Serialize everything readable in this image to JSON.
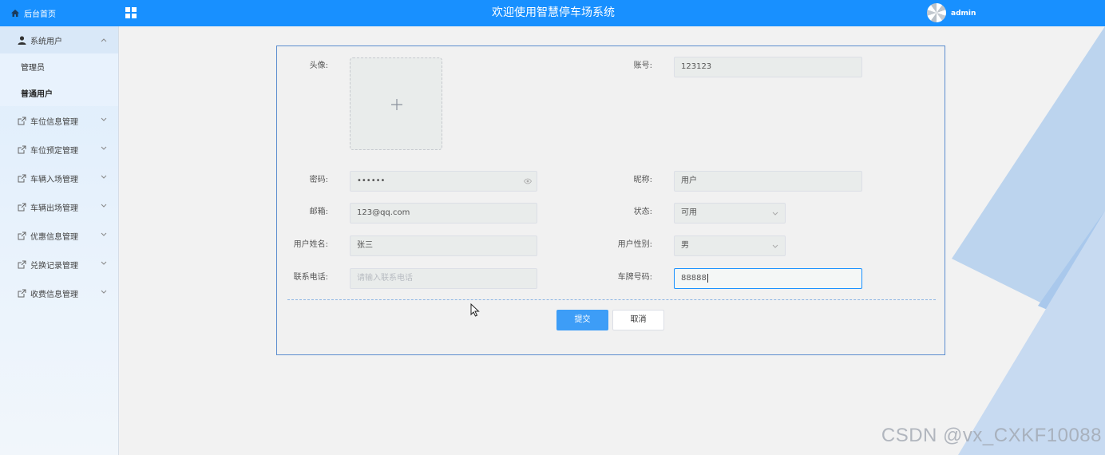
{
  "sidebar": {
    "home_label": "后台首页",
    "group_open": {
      "label": "系统用户"
    },
    "sub_items": [
      {
        "label": "管理员"
      },
      {
        "label": "普通用户"
      }
    ],
    "items": [
      {
        "label": "车位信息管理"
      },
      {
        "label": "车位预定管理"
      },
      {
        "label": "车辆入场管理"
      },
      {
        "label": "车辆出场管理"
      },
      {
        "label": "优惠信息管理"
      },
      {
        "label": "兑换记录管理"
      },
      {
        "label": "收费信息管理"
      }
    ]
  },
  "header": {
    "title": "欢迎使用智慧停车场系统",
    "username": "admin"
  },
  "form": {
    "avatar_label": "头像:",
    "account_label": "账号:",
    "account_value": "123123",
    "password_label": "密码:",
    "password_value": "••••••",
    "nickname_label": "昵称:",
    "nickname_value": "用户",
    "email_label": "邮箱:",
    "email_value": "123@qq.com",
    "status_label": "状态:",
    "status_value": "可用",
    "name_label": "用户姓名:",
    "name_value": "张三",
    "gender_label": "用户性别:",
    "gender_value": "男",
    "phone_label": "联系电话:",
    "phone_placeholder": "请输入联系电话",
    "plate_label": "车牌号码:",
    "plate_value": "88888",
    "submit_label": "提交",
    "cancel_label": "取消"
  },
  "watermark": "CSDN @vx_CXKF10088",
  "colors": {
    "primary": "#1890ff",
    "card_border": "#5b8dcf",
    "button": "#3d9df7"
  }
}
